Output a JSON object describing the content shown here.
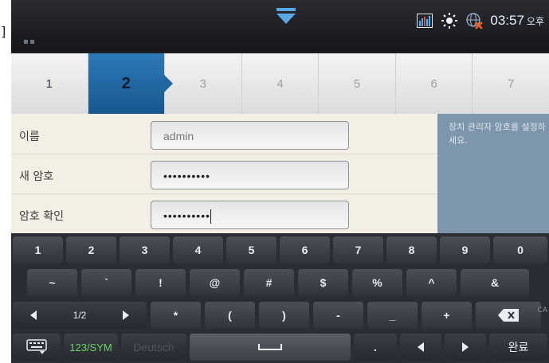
{
  "stray_glyph": "]",
  "status": {
    "time": "03:57",
    "ampm": "오후"
  },
  "steps": [
    "1",
    "2",
    "3",
    "4",
    "5",
    "6",
    "7"
  ],
  "active_step": 2,
  "form": {
    "name_label": "이름",
    "name_value": "admin",
    "new_pw_label": "새 암호",
    "new_pw_value": "••••••••••",
    "confirm_pw_label": "암호 확인",
    "confirm_pw_value": "••••••••••",
    "help_text": "장치 관리자 암호를 설정하세요."
  },
  "keyboard": {
    "row1": [
      "1",
      "2",
      "3",
      "4",
      "5",
      "6",
      "7",
      "8",
      "9",
      "0"
    ],
    "row2": [
      "~",
      "`",
      "!",
      "@",
      "#",
      "$",
      "%",
      "^",
      "&"
    ],
    "row3": [
      "*",
      "(",
      ")",
      "-",
      "_",
      "+"
    ],
    "page": "1/2",
    "sym_label": "123/SYM",
    "faint_label": "Deutsch",
    "dot": ".",
    "done": "완료",
    "caps_hint": "CA"
  }
}
